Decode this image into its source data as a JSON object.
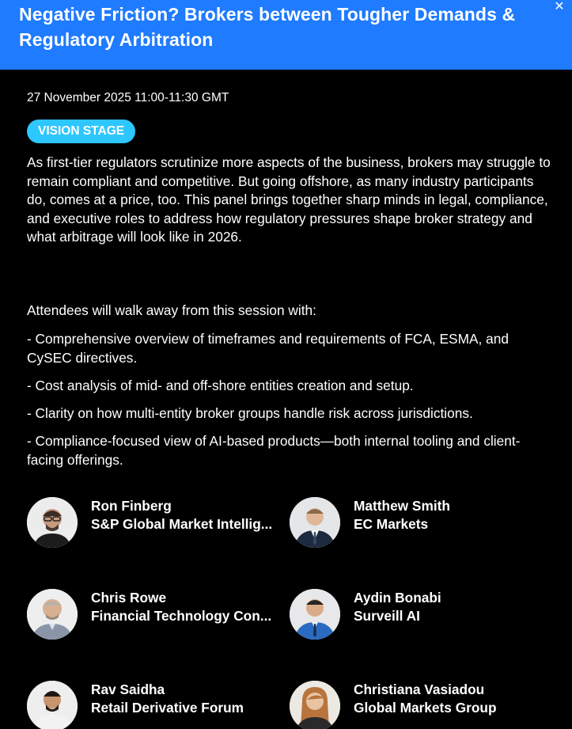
{
  "session": {
    "title": "Negative Friction? Brokers between Tougher Demands & Regulatory Arbitration",
    "datetime": "27 November 2025 11:00-11:30 GMT",
    "stage": "VISION STAGE",
    "description": "As first-tier regulators scrutinize more aspects of the business, brokers may struggle to remain compliant and competitive. But going offshore, as many industry participants do, comes at a price, too.  This panel brings together sharp minds in legal, compliance, and executive roles to address how regulatory pressures shape broker strategy and what arbitrage will look like in 2026.",
    "intro": "Attendees will walk away from this session with:",
    "bullets": [
      "- Comprehensive overview of timeframes and requirements of FCA, ESMA, and CySEC directives.",
      "- Cost analysis of mid- and off-shore entities creation and setup.",
      "- Clarity on how multi-entity broker groups handle risk across jurisdictions.",
      "- Compliance-focused view of AI-based products—both internal tooling and client-facing offerings."
    ]
  },
  "speakers": [
    {
      "name": "Ron Finberg",
      "org": "S&P Global Market Intellig..."
    },
    {
      "name": "Matthew Smith",
      "org": "EC Markets"
    },
    {
      "name": "Chris Rowe",
      "org": "Financial Technology Con..."
    },
    {
      "name": "Aydin Bonabi",
      "org": "Surveill AI"
    },
    {
      "name": "Rav Saidha",
      "org": "Retail Derivative Forum"
    },
    {
      "name": "Christiana Vasiadou",
      "org": "Global Markets Group"
    }
  ],
  "icons": {
    "close": "close-icon",
    "avatar": "avatar"
  },
  "colors": {
    "header": "#1f7bff",
    "badge": "#2ec6ff",
    "background": "#000000"
  }
}
